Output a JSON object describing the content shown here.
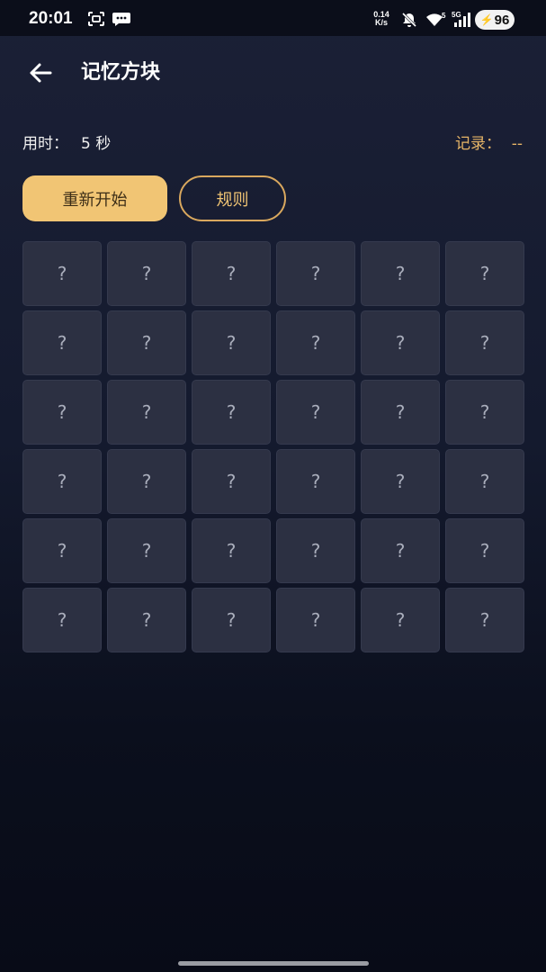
{
  "status_bar": {
    "time": "20:01",
    "net_speed_value": "0.14",
    "net_speed_unit": "K/s",
    "wifi_badge": "5",
    "signal_badge": "5G",
    "battery": "96",
    "icons": [
      "screenshot-icon",
      "chat-bubble-icon",
      "mute-icon",
      "wifi-icon",
      "cellular-signal-icon",
      "battery-charging-icon"
    ]
  },
  "header": {
    "title": "记忆方块",
    "back_icon": "arrow-left-icon"
  },
  "stats": {
    "time_label": "用时：",
    "time_value": "5 秒",
    "record_label": "记录：",
    "record_value": "--"
  },
  "buttons": {
    "restart": "重新开始",
    "rules": "规则"
  },
  "board": {
    "rows": 6,
    "cols": 6,
    "cells": [
      [
        "?",
        "?",
        "?",
        "?",
        "?",
        "?"
      ],
      [
        "?",
        "?",
        "?",
        "?",
        "?",
        "?"
      ],
      [
        "?",
        "?",
        "?",
        "?",
        "?",
        "?"
      ],
      [
        "?",
        "?",
        "?",
        "?",
        "?",
        "?"
      ],
      [
        "?",
        "?",
        "?",
        "?",
        "?",
        "?"
      ],
      [
        "?",
        "?",
        "?",
        "?",
        "?",
        "?"
      ]
    ]
  },
  "colors": {
    "accent": "#f1c574",
    "record_text": "#e7b567",
    "cell_bg": "#2c3042",
    "background": "#141a2e"
  }
}
